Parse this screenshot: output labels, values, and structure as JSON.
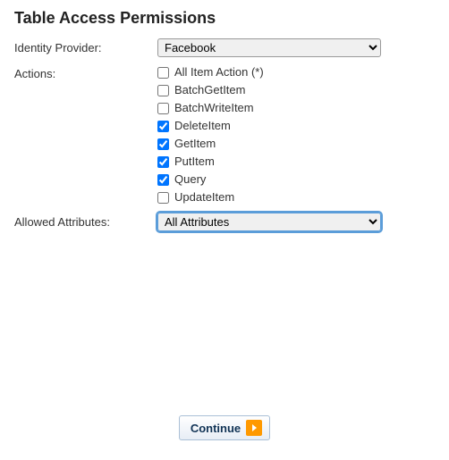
{
  "heading": "Table Access Permissions",
  "labels": {
    "identity_provider": "Identity Provider:",
    "actions": "Actions:",
    "allowed_attributes": "Allowed Attributes:"
  },
  "identity_provider": {
    "selected": "Facebook"
  },
  "actions": [
    {
      "label": "All Item Action (*)",
      "checked": false
    },
    {
      "label": "BatchGetItem",
      "checked": false
    },
    {
      "label": "BatchWriteItem",
      "checked": false
    },
    {
      "label": "DeleteItem",
      "checked": true
    },
    {
      "label": "GetItem",
      "checked": true
    },
    {
      "label": "PutItem",
      "checked": true
    },
    {
      "label": "Query",
      "checked": true
    },
    {
      "label": "UpdateItem",
      "checked": false
    }
  ],
  "allowed_attributes": {
    "selected": "All Attributes"
  },
  "buttons": {
    "continue": "Continue"
  }
}
